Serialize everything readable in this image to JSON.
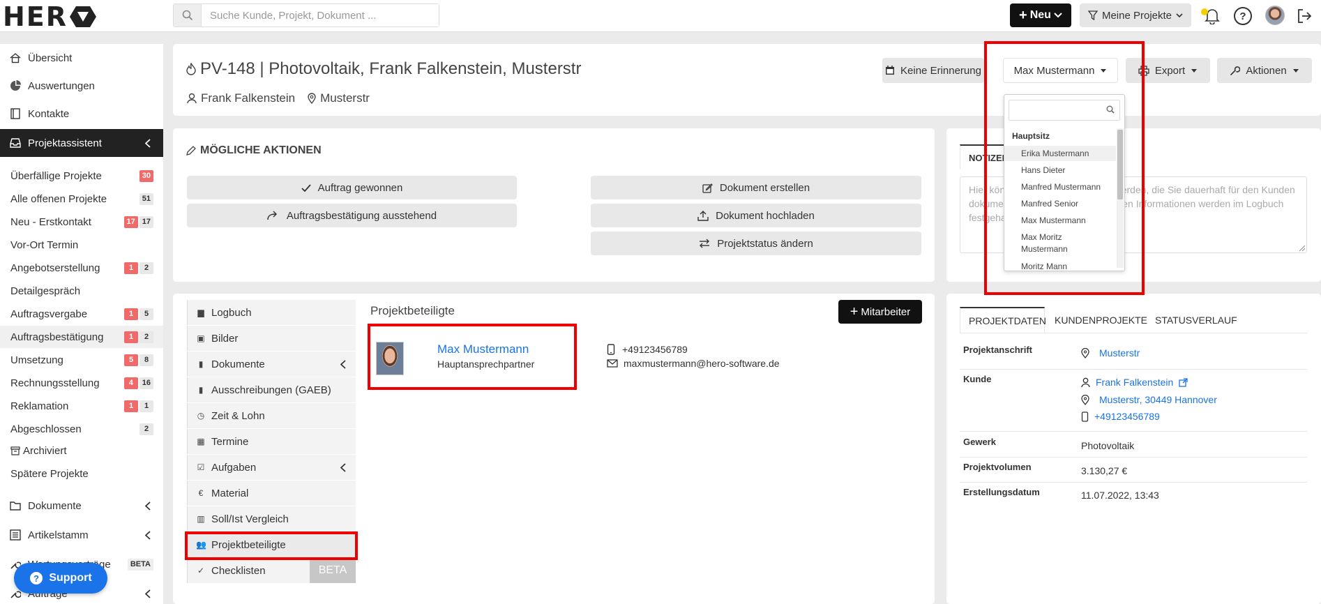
{
  "topbar": {
    "logo": "HER",
    "search_placeholder": "Suche Kunde, Projekt, Dokument ...",
    "new_label": "Neu",
    "filter_label": "Meine Projekte"
  },
  "sidebar": {
    "overview": "Übersicht",
    "reports": "Auswertungen",
    "contacts": "Kontakte",
    "assistant": "Projektassistent",
    "phases": [
      {
        "label": "Überfällige Projekte",
        "badges": [
          {
            "v": "30",
            "c": "red"
          }
        ]
      },
      {
        "label": "Alle offenen Projekte",
        "badges": [
          {
            "v": "51",
            "c": "gray"
          }
        ]
      },
      {
        "label": "Neu - Erstkontakt",
        "badges": [
          {
            "v": "17",
            "c": "red"
          },
          {
            "v": "17",
            "c": "gray"
          }
        ]
      },
      {
        "label": "Vor-Ort Termin",
        "badges": []
      },
      {
        "label": "Angebotserstellung",
        "badges": [
          {
            "v": "1",
            "c": "red"
          },
          {
            "v": "2",
            "c": "gray"
          }
        ]
      },
      {
        "label": "Detailgespräch",
        "badges": []
      },
      {
        "label": "Auftragsvergabe",
        "badges": [
          {
            "v": "1",
            "c": "red"
          },
          {
            "v": "5",
            "c": "gray"
          }
        ]
      },
      {
        "label": "Auftragsbestätigung",
        "badges": [
          {
            "v": "1",
            "c": "red"
          },
          {
            "v": "2",
            "c": "gray"
          }
        ]
      },
      {
        "label": "Umsetzung",
        "badges": [
          {
            "v": "5",
            "c": "red"
          },
          {
            "v": "8",
            "c": "gray"
          }
        ]
      },
      {
        "label": "Rechnungsstellung",
        "badges": [
          {
            "v": "4",
            "c": "red"
          },
          {
            "v": "16",
            "c": "gray"
          }
        ]
      },
      {
        "label": "Reklamation",
        "badges": [
          {
            "v": "1",
            "c": "red"
          },
          {
            "v": "1",
            "c": "gray"
          }
        ]
      },
      {
        "label": "Abgeschlossen",
        "badges": [
          {
            "v": "2",
            "c": "gray"
          }
        ]
      }
    ],
    "archived": "Archiviert",
    "later": "Spätere Projekte",
    "documents": "Dokumente",
    "articles": "Artikelstamm",
    "hidden_item": "Wartungsverträge",
    "beta": "BETA",
    "orders": "Aufträge",
    "support": "Support"
  },
  "project": {
    "title": "PV-148 | Photovoltaik, Frank Falkenstein, Musterstr",
    "customer": "Frank Falkenstein",
    "location": "Musterstr",
    "reminder": "Keine Erinnerung",
    "assignee": "Max Mustermann",
    "export": "Export",
    "actions": "Aktionen"
  },
  "dropdown": {
    "group": "Hauptsitz",
    "items": [
      "Erika Mustermann",
      "Hans Dieter",
      "Manfred Mustermann",
      "Manfred Senior",
      "Max Mustermann",
      "Max Moritz Mustermann",
      "Moritz Mann"
    ]
  },
  "possible_actions": {
    "title": "MÖGLICHE AKTIONEN",
    "won": "Auftrag gewonnen",
    "pending": "Auftragsbestätigung ausstehend",
    "create_doc": "Dokument erstellen",
    "upload_doc": "Dokument hochladen",
    "change_status": "Projektstatus ändern"
  },
  "notes": {
    "tab": "NOTIZEN",
    "text": "Hier können Notizen eingetragen werden, die Sie dauerhaft für den Kunden dokumentieren möchten. Alle anderen Informationen werden im Logbuch festgehalten."
  },
  "project_nav": [
    "Logbuch",
    "Bilder",
    "Dokumente",
    "Ausschreibungen (GAEB)",
    "Zeit & Lohn",
    "Termine",
    "Aufgaben",
    "Material",
    "Soll/Ist Vergleich",
    "Projektbeteiligte",
    "Checklisten"
  ],
  "nav_beta": "BETA",
  "participants": {
    "title": "Projektbeteiligte",
    "add_button": "Mitarbeiter",
    "name": "Max Mustermann",
    "role": "Hauptansprechpartner",
    "phone": "+49123456789",
    "email": "maxmustermann@hero-software.de"
  },
  "details": {
    "tabs": [
      "PROJEKTDATEN",
      "KUNDENPROJEKTE",
      "STATUSVERLAUF"
    ],
    "address_label": "Projektanschrift",
    "address": "Musterstr",
    "customer_label": "Kunde",
    "customer_name": "Frank Falkenstein",
    "customer_address": "Musterstr, 30449 Hannover",
    "customer_phone": "+49123456789",
    "trade_label": "Gewerk",
    "trade": "Photovoltaik",
    "volume_label": "Projektvolumen",
    "volume": "3.130,27 €",
    "created_label": "Erstellungsdatum",
    "created": "11.07.2022, 13:43"
  },
  "colors": {
    "accent": "#1a73e8",
    "alert": "#f06a6a",
    "highlight": "#ee0000"
  }
}
